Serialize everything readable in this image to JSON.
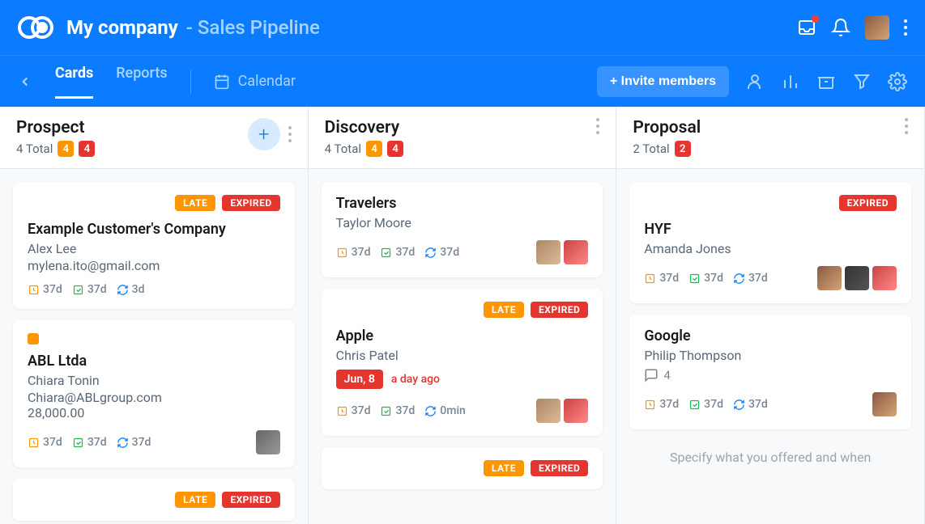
{
  "header": {
    "company": "My company",
    "pipeline": "- Sales Pipeline"
  },
  "tabs": {
    "cards": "Cards",
    "reports": "Reports",
    "calendar": "Calendar"
  },
  "invite_label": "+ Invite members",
  "columns": [
    {
      "title": "Prospect",
      "total_label": "4 Total",
      "badges": [
        "4",
        "4"
      ]
    },
    {
      "title": "Discovery",
      "total_label": "4 Total",
      "badges": [
        "4",
        "4"
      ]
    },
    {
      "title": "Proposal",
      "total_label": "2 Total",
      "badges": [
        "2"
      ]
    }
  ],
  "cards": {
    "prospect": [
      {
        "tags": [
          "LATE",
          "EXPIRED"
        ],
        "title": "Example Customer's Company",
        "person": "Alex Lee",
        "email": "mylena.ito@gmail.com",
        "m1": "37d",
        "m2": "37d",
        "m3": "3d"
      },
      {
        "status_dot": true,
        "title": "ABL Ltda",
        "person": "Chiara Tonin",
        "email": "Chiara@ABLgroup.com",
        "amount": "28,000.00",
        "m1": "37d",
        "m2": "37d",
        "m3": "37d"
      },
      {
        "tags": [
          "LATE",
          "EXPIRED"
        ]
      }
    ],
    "discovery": [
      {
        "title": "Travelers",
        "person": "Taylor Moore",
        "m1": "37d",
        "m2": "37d",
        "m3": "37d"
      },
      {
        "tags": [
          "LATE",
          "EXPIRED"
        ],
        "title": "Apple",
        "person": "Chris Patel",
        "date": "Jun, 8",
        "ago": "a day ago",
        "m1": "37d",
        "m2": "37d",
        "m3": "0min"
      },
      {
        "tags": [
          "LATE",
          "EXPIRED"
        ]
      }
    ],
    "proposal": [
      {
        "tags": [
          "EXPIRED"
        ],
        "title": "HYF",
        "person": "Amanda Jones",
        "m1": "37d",
        "m2": "37d",
        "m3": "37d"
      },
      {
        "title": "Google",
        "person": "Philip Thompson",
        "comments": "4",
        "m1": "37d",
        "m2": "37d",
        "m3": "37d"
      }
    ]
  },
  "placeholder": "Specify what you offered and when"
}
